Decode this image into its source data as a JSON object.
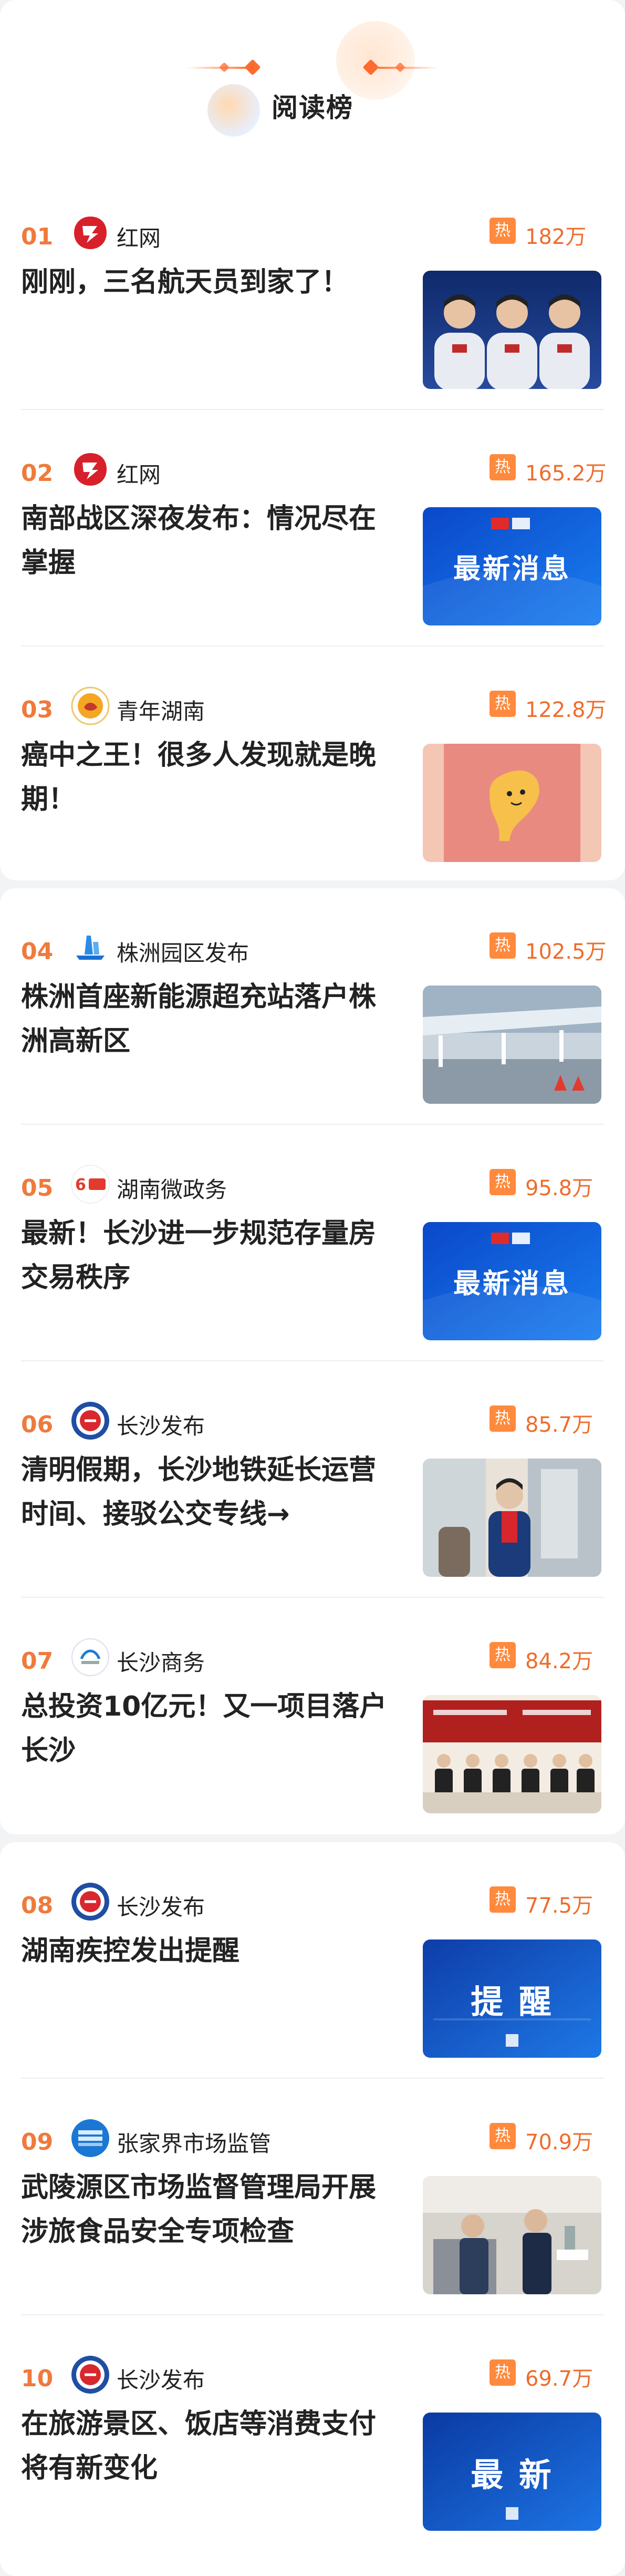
{
  "title": "阅读榜",
  "hot_label": "热",
  "items": [
    {
      "rank": "01",
      "source": "红网",
      "logo": "hongwang-logo",
      "count": "182万",
      "headline": "刚刚，三名航天员到家了！",
      "image": "astronauts"
    },
    {
      "rank": "02",
      "source": "红网",
      "logo": "hongwang-logo",
      "count": "165.2万",
      "headline": "南部战区深夜发布：情况尽在掌握",
      "image_text": "最新消息",
      "image": "news-blue"
    },
    {
      "rank": "03",
      "source": "青年湖南",
      "logo": "qingnian-logo",
      "count": "122.8万",
      "headline": "癌中之王！很多人发现就是晚期！",
      "image": "pancreas-cartoon"
    },
    {
      "rank": "04",
      "source": "株洲园区发布",
      "logo": "zhuzhou-logo",
      "count": "102.5万",
      "headline": "株洲首座新能源超充站落户株洲高新区",
      "image": "charging-station"
    },
    {
      "rank": "05",
      "source": "湖南微政务",
      "logo": "weizhengwu-logo",
      "count": "95.8万",
      "headline": "最新！长沙进一步规范存量房交易秩序",
      "image_text": "最新消息",
      "image": "news-blue"
    },
    {
      "rank": "06",
      "source": "长沙发布",
      "logo": "changsha-logo",
      "count": "85.7万",
      "headline": "清明假期，长沙地铁延长运营时间、接驳公交专线→",
      "image": "metro-staff"
    },
    {
      "rank": "07",
      "source": "长沙商务",
      "logo": "changsha-commerce-logo",
      "count": "84.2万",
      "headline": "总投资10亿元！又一项目落户长沙",
      "image": "signing-ceremony"
    },
    {
      "rank": "08",
      "source": "长沙发布",
      "logo": "changsha-logo",
      "count": "77.5万",
      "headline": "湖南疾控发出提醒",
      "image_text": "提 醒",
      "image": "reminder-blue"
    },
    {
      "rank": "09",
      "source": "张家界市场监管",
      "logo": "zhangjiajie-logo",
      "count": "70.9万",
      "headline": "武陵源区市场监督管理局开展涉旅食品安全专项检查",
      "image": "inspection"
    },
    {
      "rank": "10",
      "source": "长沙发布",
      "logo": "changsha-logo",
      "count": "69.7万",
      "headline": "在旅游景区、饭店等消费支付将有新变化",
      "image_text": "最 新",
      "image": "latest-blue"
    }
  ],
  "colors": {
    "accent": "#ef7a3c",
    "hot": "#ff8a3d",
    "news_blue": "#1566d6"
  }
}
